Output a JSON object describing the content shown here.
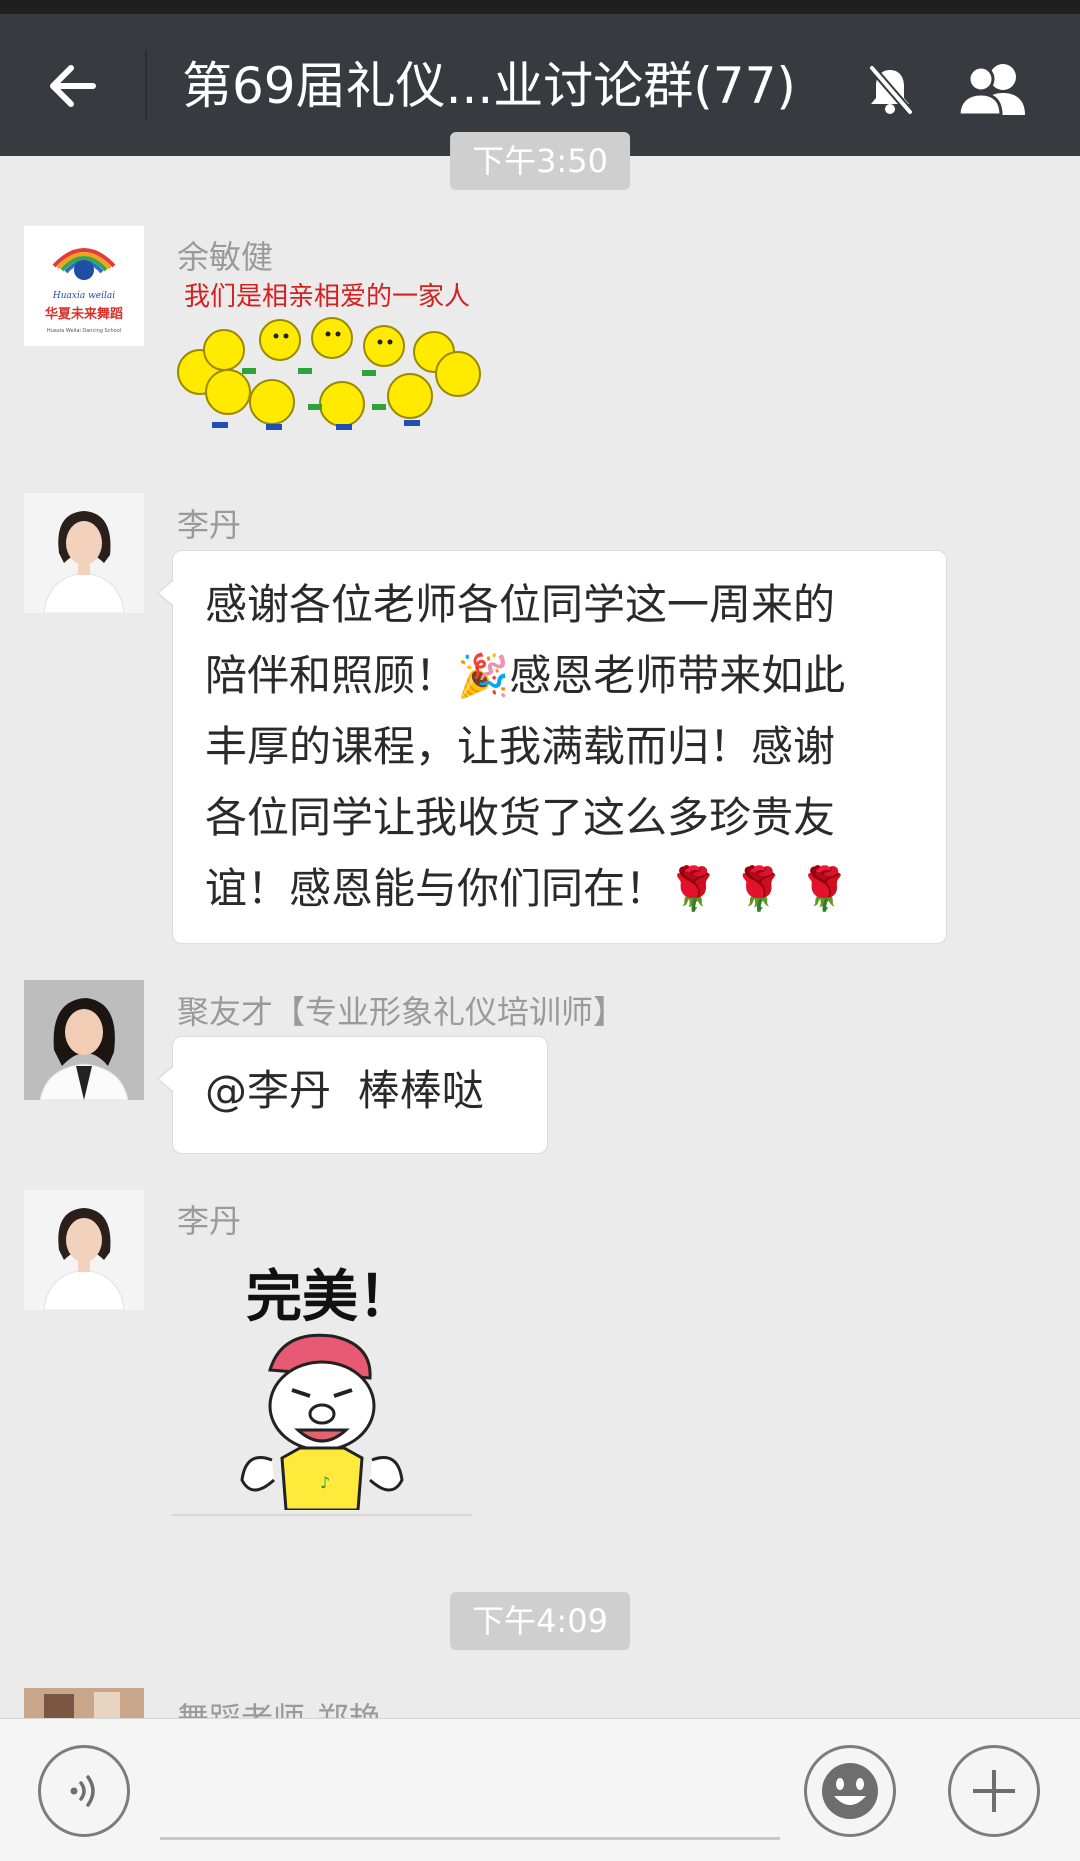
{
  "header": {
    "title": "第69届礼仪...业讨论群(77)",
    "back_icon": "back-arrow-icon",
    "mute_icon": "bell-muted-icon",
    "members_icon": "group-members-icon"
  },
  "timestamps": [
    "下午3:50",
    "下午4:09"
  ],
  "messages": [
    {
      "sender": "余敏健",
      "type": "sticker",
      "sticker_caption": "我们是相亲相爱的一家人",
      "avatar_lines": [
        "Huaxia weilai",
        "华夏未来舞蹈",
        "Huaxia Weilai Dancing School"
      ]
    },
    {
      "sender": "李丹",
      "type": "text",
      "lines": [
        "感谢各位老师各位同学这一周来的",
        "陪伴和照顾！🎉感恩老师带来如此",
        "丰厚的课程，让我满载而归！感谢",
        "各位同学让我收货了这么多珍贵友",
        "谊！感恩能与你们同在！🌹 🌹 🌹"
      ]
    },
    {
      "sender": "聚友才【专业形象礼仪培训师】",
      "type": "text",
      "lines": [
        "@李丹  棒棒哒"
      ]
    },
    {
      "sender": "李丹",
      "type": "sticker",
      "sticker_caption": "完美！"
    },
    {
      "sender": "舞蹈老师-郑艳",
      "type": "partial"
    }
  ],
  "composer": {
    "voice_icon": "voice-input-icon",
    "emoji_icon": "emoji-icon",
    "plus_icon": "plus-icon"
  }
}
